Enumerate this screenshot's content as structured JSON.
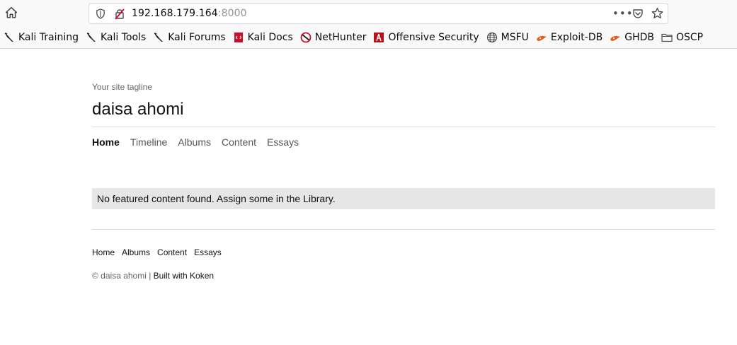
{
  "browser": {
    "url_host": "192.168.179.164",
    "url_port": ":8000",
    "page_actions_glyph": "•••",
    "bookmarks": [
      {
        "label": "Kali Training",
        "icon": "kali-dragon-icon"
      },
      {
        "label": "Kali Tools",
        "icon": "kali-dragon-icon"
      },
      {
        "label": "Kali Forums",
        "icon": "kali-dragon-icon"
      },
      {
        "label": "Kali Docs",
        "icon": "kali-docs-icon"
      },
      {
        "label": "NetHunter",
        "icon": "nethunter-icon"
      },
      {
        "label": "Offensive Security",
        "icon": "offsec-icon"
      },
      {
        "label": "MSFU",
        "icon": "globe-icon"
      },
      {
        "label": "Exploit-DB",
        "icon": "exploitdb-icon"
      },
      {
        "label": "GHDB",
        "icon": "exploitdb-icon"
      },
      {
        "label": "OSCP",
        "icon": "folder-icon"
      }
    ]
  },
  "site": {
    "tagline": "Your site tagline",
    "title": "daisa ahomi",
    "nav": [
      {
        "label": "Home",
        "active": true
      },
      {
        "label": "Timeline",
        "active": false
      },
      {
        "label": "Albums",
        "active": false
      },
      {
        "label": "Content",
        "active": false
      },
      {
        "label": "Essays",
        "active": false
      }
    ],
    "notice": "No featured content found. Assign some in the Library.",
    "footer_nav": [
      "Home",
      "Albums",
      "Content",
      "Essays"
    ],
    "copyright_prefix": "© daisa ahomi | ",
    "copyright_link": "Built with Koken"
  },
  "colors": {
    "notice_bg": "#e6e6e6",
    "divider": "#d9d9d9",
    "muted_text": "#666666"
  }
}
